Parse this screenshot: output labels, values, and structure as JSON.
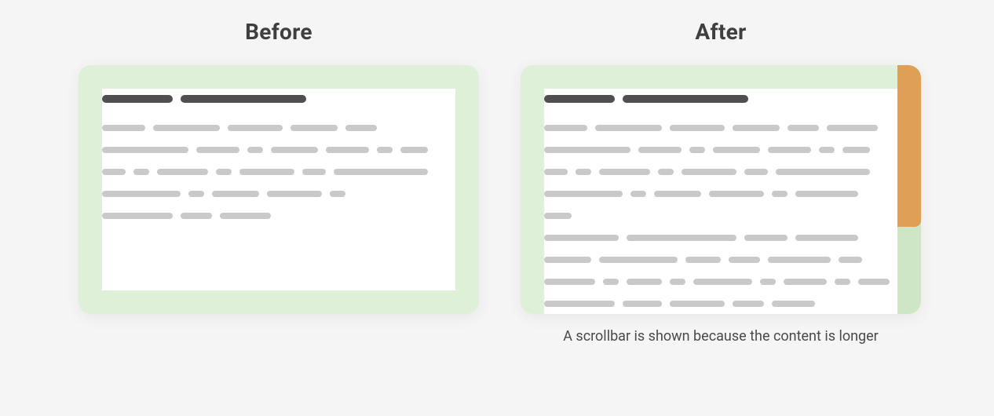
{
  "before": {
    "title": "Before"
  },
  "after": {
    "title": "After",
    "caption": "A scrollbar is shown because the content is longer"
  },
  "colors": {
    "padding": "#dff0d9",
    "scrollbar_thumb": "#df9f57",
    "placeholder_text": "#c9c9c9",
    "heading_text": "#4f4f4f"
  }
}
